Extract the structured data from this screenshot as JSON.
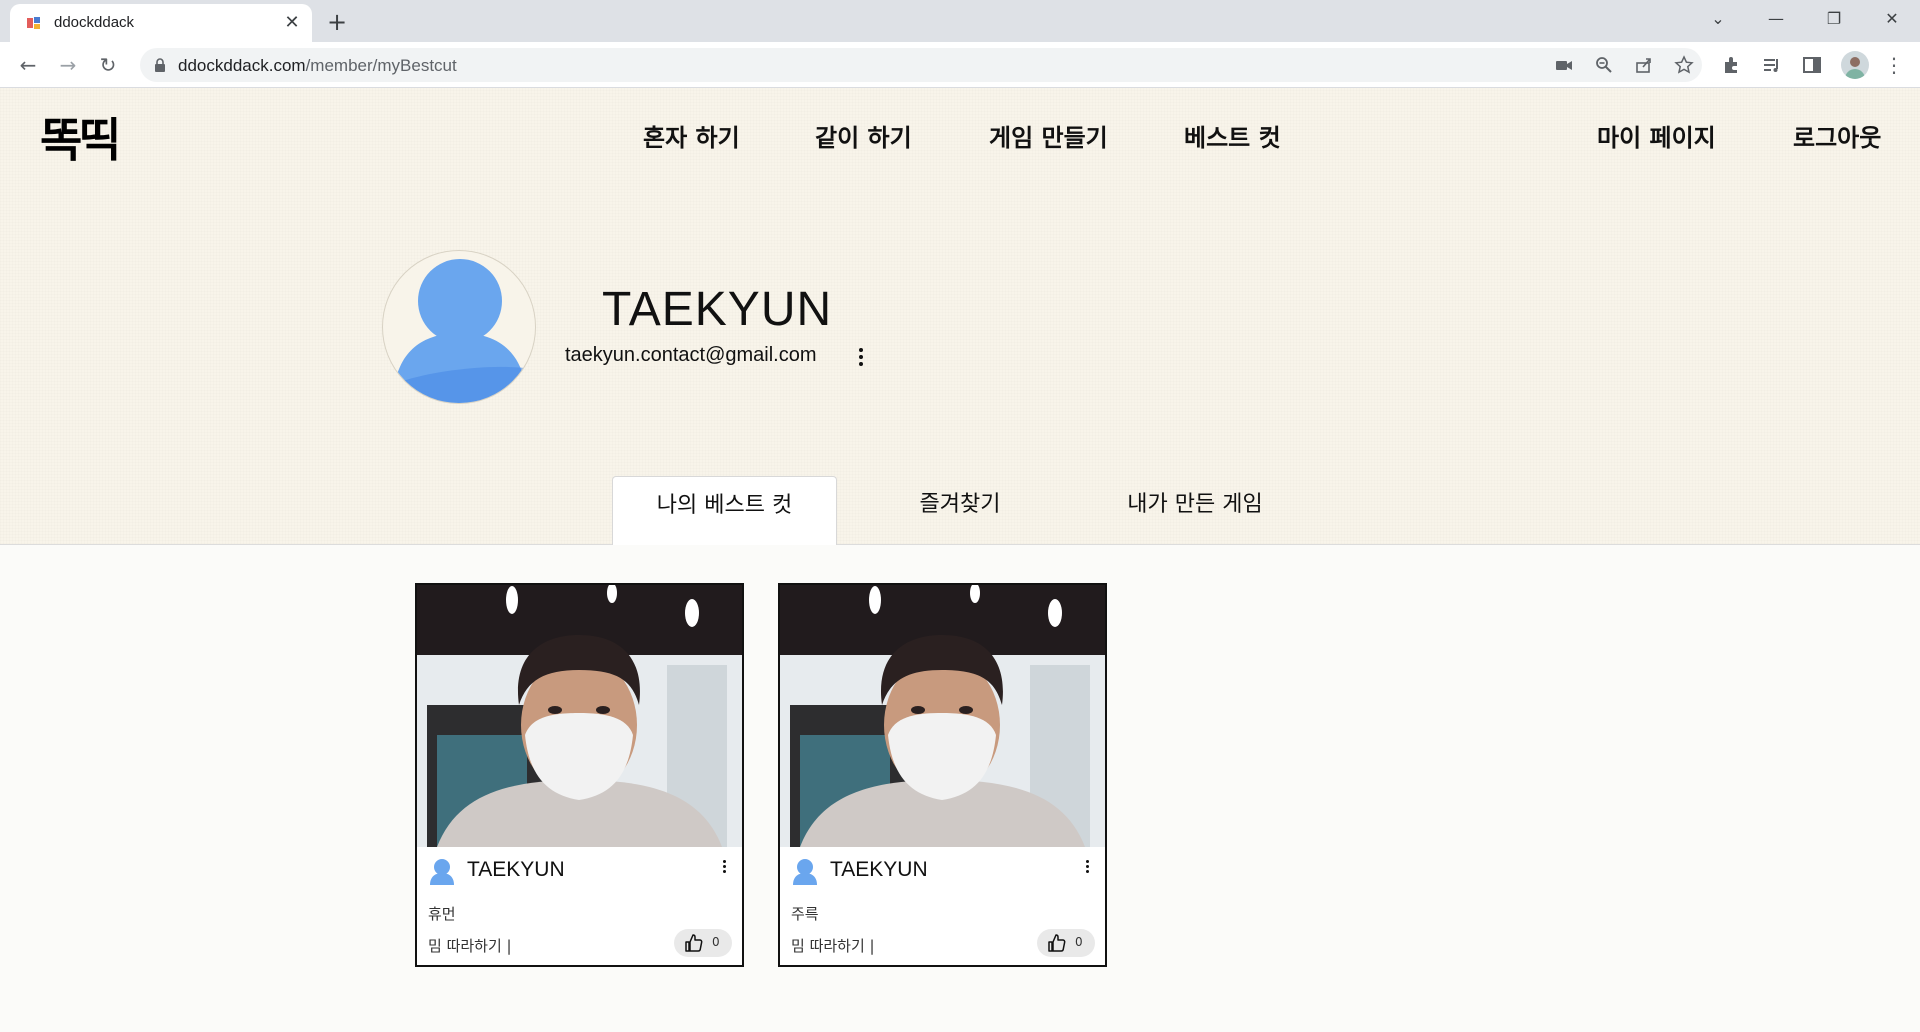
{
  "browser": {
    "tab_title": "ddockddack",
    "url_host": "ddockddack.com",
    "url_path": "/member/myBestcut",
    "icons": [
      "back-icon",
      "forward-icon",
      "reload-icon",
      "lock-icon",
      "camera-icon",
      "zoom-icon",
      "share-icon",
      "star-icon",
      "extensions-icon",
      "media-icon",
      "sidepanel-icon",
      "menu-icon"
    ]
  },
  "header": {
    "logo": "똑띡",
    "nav": [
      "혼자 하기",
      "같이 하기",
      "게임 만들기",
      "베스트 컷"
    ],
    "right_nav": [
      "마이 페이지",
      "로그아웃"
    ]
  },
  "profile": {
    "name": "TAEKYUN",
    "email": "taekyun.contact@gmail.com"
  },
  "tabs": [
    "나의 베스트 컷",
    "즐겨찾기",
    "내가 만든 게임"
  ],
  "active_tab": "나의 베스트 컷",
  "cards": [
    {
      "user": "TAEKYUN",
      "title": "휴먼",
      "category": "밈 따라하기 |",
      "likes": "0"
    },
    {
      "user": "TAEKYUN",
      "title": "주륵",
      "category": "밈 따라하기 |",
      "likes": "0"
    }
  ],
  "colors": {
    "page_bg": "#f8f4ea",
    "avatar_blue": "#6aa6ee",
    "border": "#111111"
  }
}
